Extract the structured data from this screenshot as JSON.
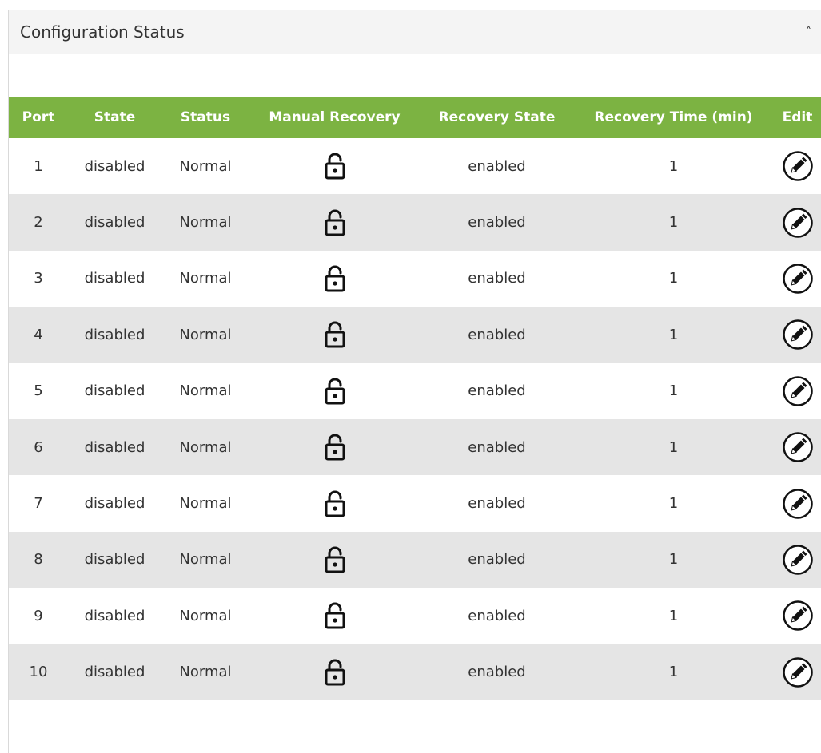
{
  "panel": {
    "title": "Configuration Status",
    "collapse_icon": "chevron-up-icon"
  },
  "table": {
    "headers": [
      "Port",
      "State",
      "Status",
      "Manual Recovery",
      "Recovery State",
      "Recovery Time (min)",
      "Edit"
    ],
    "header_color": "#7cb342",
    "stripe_color": "#e5e5e5",
    "manual_recovery_icon": "unlock-icon",
    "edit_icon": "pencil-icon",
    "rows": [
      {
        "port": "1",
        "state": "disabled",
        "status": "Normal",
        "recovery_state": "enabled",
        "recovery_time": "1"
      },
      {
        "port": "2",
        "state": "disabled",
        "status": "Normal",
        "recovery_state": "enabled",
        "recovery_time": "1"
      },
      {
        "port": "3",
        "state": "disabled",
        "status": "Normal",
        "recovery_state": "enabled",
        "recovery_time": "1"
      },
      {
        "port": "4",
        "state": "disabled",
        "status": "Normal",
        "recovery_state": "enabled",
        "recovery_time": "1"
      },
      {
        "port": "5",
        "state": "disabled",
        "status": "Normal",
        "recovery_state": "enabled",
        "recovery_time": "1"
      },
      {
        "port": "6",
        "state": "disabled",
        "status": "Normal",
        "recovery_state": "enabled",
        "recovery_time": "1"
      },
      {
        "port": "7",
        "state": "disabled",
        "status": "Normal",
        "recovery_state": "enabled",
        "recovery_time": "1"
      },
      {
        "port": "8",
        "state": "disabled",
        "status": "Normal",
        "recovery_state": "enabled",
        "recovery_time": "1"
      },
      {
        "port": "9",
        "state": "disabled",
        "status": "Normal",
        "recovery_state": "enabled",
        "recovery_time": "1"
      },
      {
        "port": "10",
        "state": "disabled",
        "status": "Normal",
        "recovery_state": "enabled",
        "recovery_time": "1"
      }
    ]
  }
}
